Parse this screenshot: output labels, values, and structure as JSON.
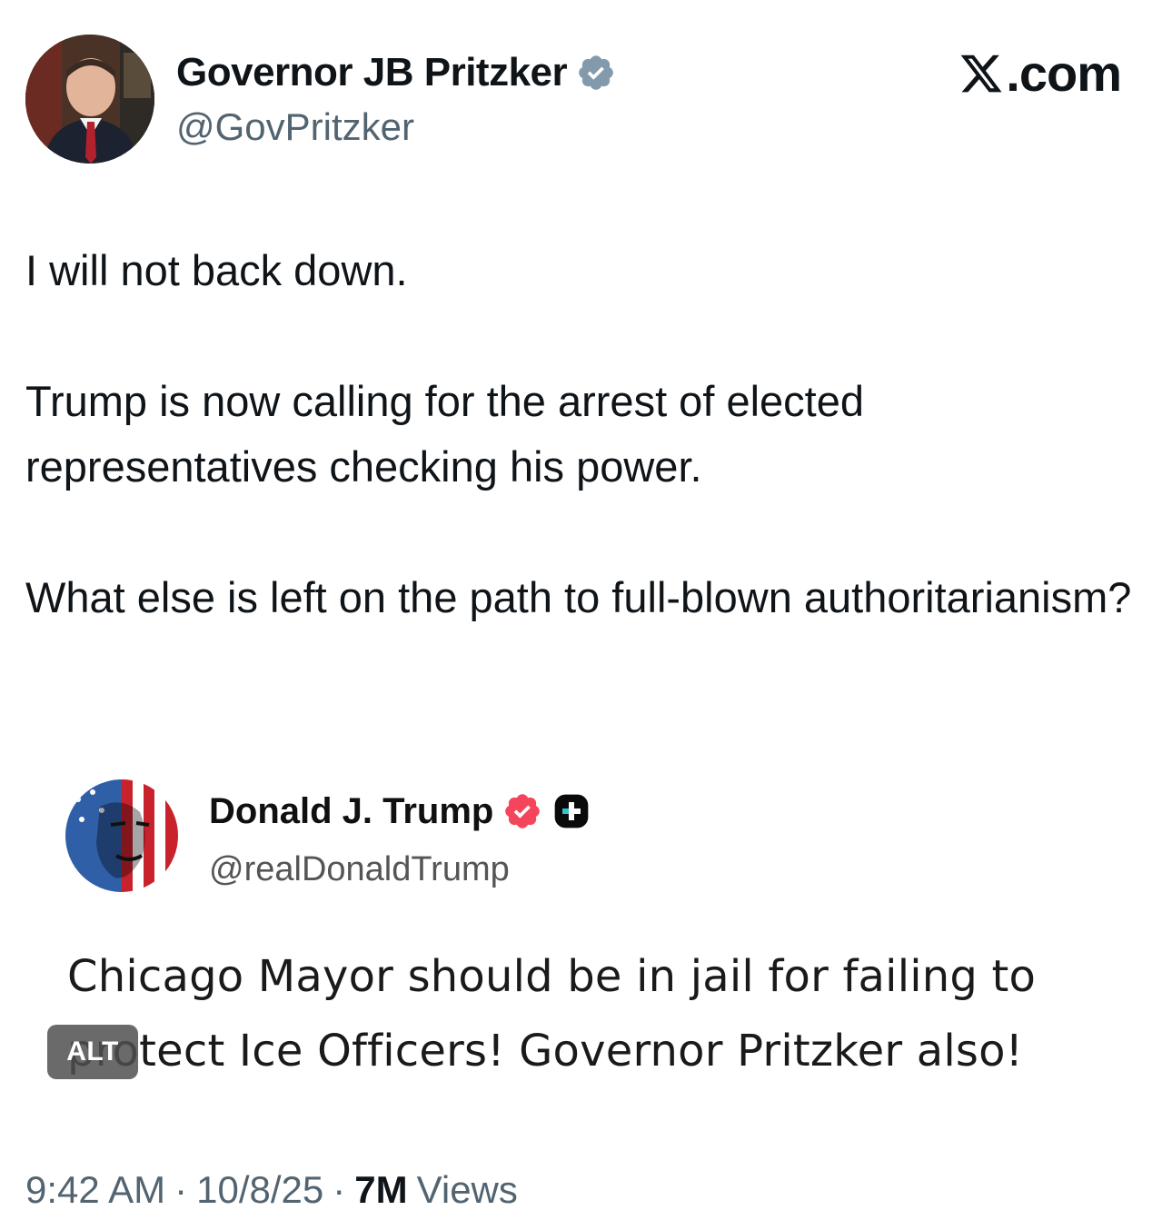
{
  "site": {
    "brand": ".com",
    "logo_icon": "x-logo-icon"
  },
  "author": {
    "name": "Governor JB Pritzker",
    "handle": "@GovPritzker",
    "verified_icon": "verified-badge-icon",
    "verified_color": "#829aab"
  },
  "tweet": {
    "paragraphs": [
      "I will not back down.",
      "Trump is now calling for the arrest of elected representatives checking his power.",
      "What else is left on the path to full-blown authoritarianism?"
    ]
  },
  "embedded_image": {
    "author_name": "Donald J. Trump",
    "author_handle": "@realDonaldTrump",
    "badge_color": "#f5455c",
    "text": "Chicago Mayor should be in jail for failing to protect Ice Officers! Governor Pritzker also!",
    "alt_label": "ALT"
  },
  "meta": {
    "time": "9:42 AM",
    "date": "10/8/25",
    "separator": "·",
    "views_count": "7M",
    "views_label": "Views"
  }
}
